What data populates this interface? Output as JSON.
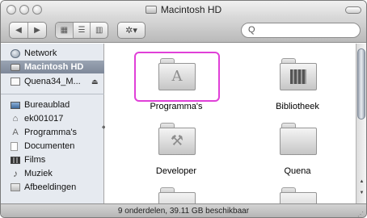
{
  "window": {
    "title": "Macintosh HD"
  },
  "toolbar": {
    "back_icon": "◀",
    "forward_icon": "▶",
    "view_icons": [
      "▦",
      "☰",
      "▥"
    ],
    "action_icon": "✲▾",
    "search": {
      "glass": "Q",
      "value": "",
      "placeholder": ""
    }
  },
  "sidebar": {
    "devices": [
      {
        "label": "Network",
        "icon": "globe"
      },
      {
        "label": "Macintosh HD",
        "icon": "hard-disk",
        "selected": true
      },
      {
        "label": "Quena34_M...",
        "icon": "disk",
        "eject": "⏏"
      }
    ],
    "places": [
      {
        "label": "Bureaublad",
        "icon": "desktop"
      },
      {
        "label": "ek001017",
        "icon": "home",
        "glyph": "⌂"
      },
      {
        "label": "Programma's",
        "icon": "applications",
        "glyph": "A"
      },
      {
        "label": "Documenten",
        "icon": "documents"
      },
      {
        "label": "Films",
        "icon": "movies"
      },
      {
        "label": "Muziek",
        "icon": "music",
        "glyph": "♪"
      },
      {
        "label": "Afbeeldingen",
        "icon": "pictures"
      }
    ]
  },
  "content": {
    "items": [
      {
        "label": "Programma's",
        "icon": "applications-folder",
        "emblem": "A",
        "highlighted": true
      },
      {
        "label": "Bibliotheek",
        "icon": "library-folder"
      },
      {
        "label": "Developer",
        "icon": "developer-folder",
        "emblem": "⚒"
      },
      {
        "label": "Quena",
        "icon": "plain-folder"
      }
    ]
  },
  "statusbar": {
    "text": "9 onderdelen, 39.11 GB beschikbaar"
  },
  "colors": {
    "highlight": "#e040d8",
    "selection": "#8a94a4"
  }
}
